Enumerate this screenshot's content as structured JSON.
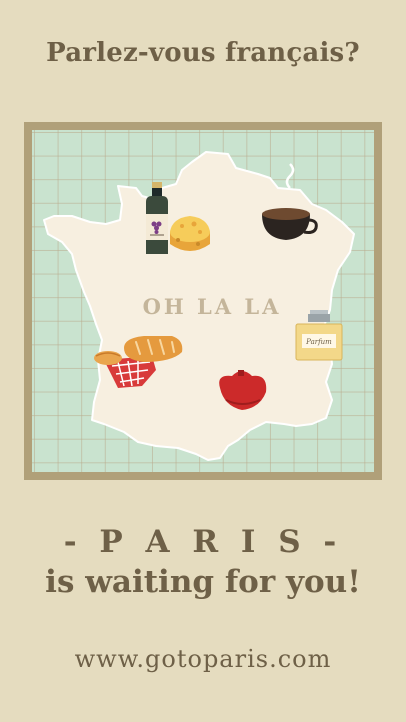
{
  "headline": "Parlez-vous français?",
  "map": {
    "center_text": "OH LA LA",
    "perfume_label": "Parfum"
  },
  "tagline": {
    "line1": "- P A R I S -",
    "line2": "is waiting for you!"
  },
  "website": "www.gotoparis.com",
  "colors": {
    "background": "#e5dcbf",
    "text": "#6e6047",
    "frame": "#b0a079",
    "map_water": "#c9e3cf",
    "country": "#f7efe0"
  },
  "icons": [
    "wine-bottle-icon",
    "cheese-icon",
    "coffee-cup-icon",
    "perfume-bottle-icon",
    "bread-basket-icon",
    "beret-icon"
  ]
}
